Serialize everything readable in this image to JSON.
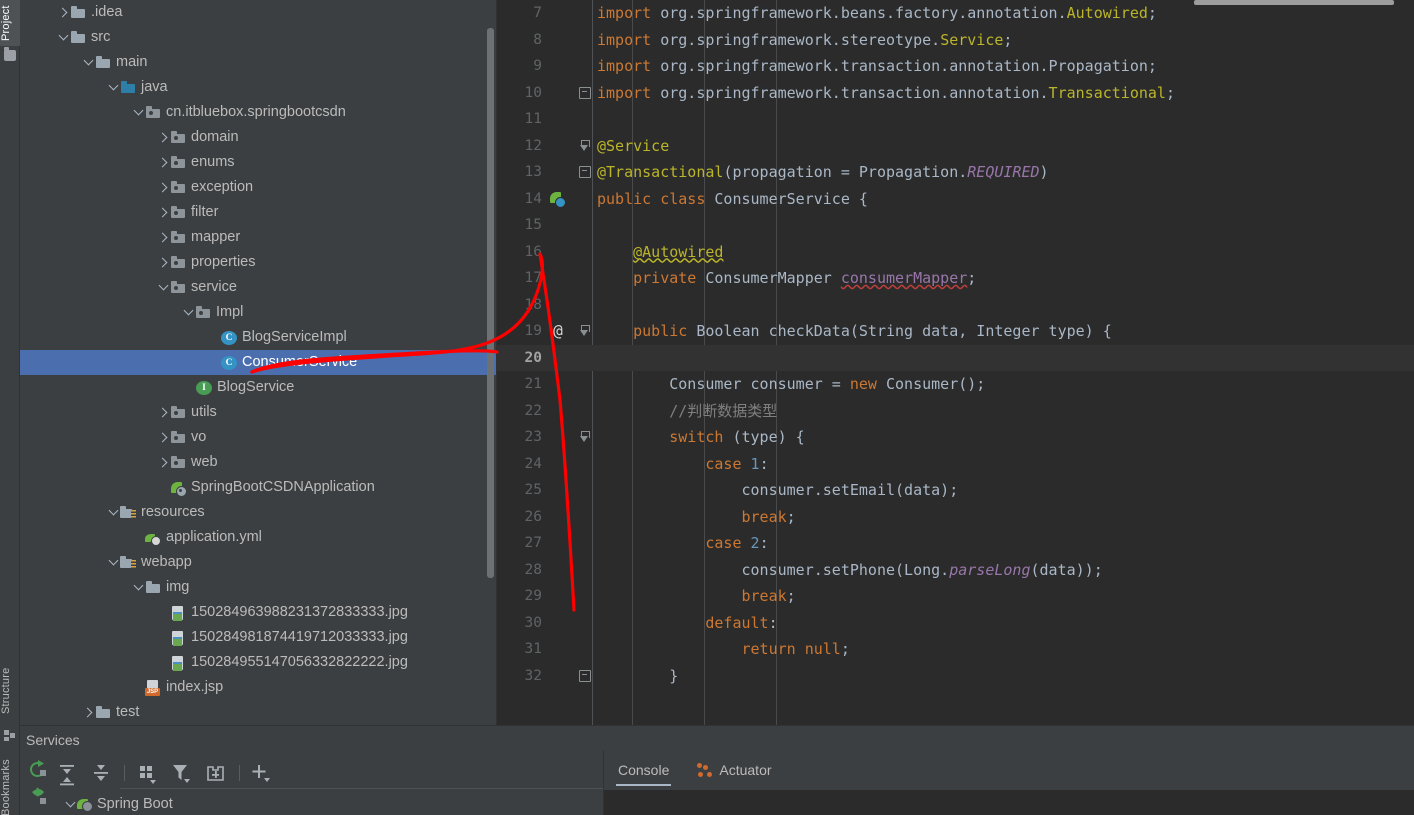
{
  "tool_strip": {
    "tabs": [
      {
        "label": "Project",
        "active": true
      },
      {
        "label": "Structure",
        "active": false
      },
      {
        "label": "Bookmarks",
        "active": false
      }
    ]
  },
  "project_tree": {
    "items": [
      {
        "label": ".idea",
        "indent": 1,
        "arrow": "right",
        "icon": "folder-icon",
        "selected": false
      },
      {
        "label": "src",
        "indent": 1,
        "arrow": "down",
        "icon": "folder-icon",
        "selected": false
      },
      {
        "label": "main",
        "indent": 2,
        "arrow": "down",
        "icon": "folder-icon",
        "selected": false
      },
      {
        "label": "java",
        "indent": 3,
        "arrow": "down",
        "icon": "source-root-icon",
        "selected": false
      },
      {
        "label": "cn.itbluebox.springbootcsdn",
        "indent": 4,
        "arrow": "down",
        "icon": "package-icon",
        "selected": false
      },
      {
        "label": "domain",
        "indent": 5,
        "arrow": "right",
        "icon": "package-icon",
        "selected": false
      },
      {
        "label": "enums",
        "indent": 5,
        "arrow": "right",
        "icon": "package-icon",
        "selected": false
      },
      {
        "label": "exception",
        "indent": 5,
        "arrow": "right",
        "icon": "package-icon",
        "selected": false
      },
      {
        "label": "filter",
        "indent": 5,
        "arrow": "right",
        "icon": "package-icon",
        "selected": false
      },
      {
        "label": "mapper",
        "indent": 5,
        "arrow": "right",
        "icon": "package-icon",
        "selected": false
      },
      {
        "label": "properties",
        "indent": 5,
        "arrow": "right",
        "icon": "package-icon",
        "selected": false
      },
      {
        "label": "service",
        "indent": 5,
        "arrow": "down",
        "icon": "package-icon",
        "selected": false
      },
      {
        "label": "Impl",
        "indent": 6,
        "arrow": "down",
        "icon": "package-icon",
        "selected": false
      },
      {
        "label": "BlogServiceImpl",
        "indent": 7,
        "arrow": "none",
        "icon": "class-icon",
        "selected": false
      },
      {
        "label": "ConsumerService",
        "indent": 7,
        "arrow": "none",
        "icon": "class-icon",
        "selected": true
      },
      {
        "label": "BlogService",
        "indent": 6,
        "arrow": "none",
        "icon": "interface-icon",
        "selected": false
      },
      {
        "label": "utils",
        "indent": 5,
        "arrow": "right",
        "icon": "package-icon",
        "selected": false
      },
      {
        "label": "vo",
        "indent": 5,
        "arrow": "right",
        "icon": "package-icon",
        "selected": false
      },
      {
        "label": "web",
        "indent": 5,
        "arrow": "right",
        "icon": "package-icon",
        "selected": false
      },
      {
        "label": "SpringBootCSDNApplication",
        "indent": 5,
        "arrow": "none",
        "icon": "spring-app-icon",
        "selected": false
      },
      {
        "label": "resources",
        "indent": 3,
        "arrow": "down",
        "icon": "resource-root-icon",
        "selected": false
      },
      {
        "label": "application.yml",
        "indent": 4,
        "arrow": "none",
        "icon": "yaml-file-icon",
        "selected": false
      },
      {
        "label": "webapp",
        "indent": 3,
        "arrow": "down",
        "icon": "resource-root-icon",
        "selected": false
      },
      {
        "label": "img",
        "indent": 4,
        "arrow": "down",
        "icon": "folder-icon",
        "selected": false
      },
      {
        "label": "150284963988231372833333.jpg",
        "indent": 5,
        "arrow": "none",
        "icon": "image-file-icon",
        "selected": false
      },
      {
        "label": "150284981874419712033333.jpg",
        "indent": 5,
        "arrow": "none",
        "icon": "image-file-icon",
        "selected": false
      },
      {
        "label": "150284955147056332822222.jpg",
        "indent": 5,
        "arrow": "none",
        "icon": "image-file-icon",
        "selected": false
      },
      {
        "label": "index.jsp",
        "indent": 4,
        "arrow": "none",
        "icon": "jsp-file-icon",
        "selected": false
      },
      {
        "label": "test",
        "indent": 2,
        "arrow": "right",
        "icon": "folder-icon",
        "selected": false
      }
    ]
  },
  "editor": {
    "lines": [
      {
        "num": "7",
        "gutter": "",
        "fold": "",
        "caret": false,
        "tokens": [
          {
            "t": "import ",
            "c": "k"
          },
          {
            "t": "org.springframework.beans.factory.annotation.",
            "c": "id"
          },
          {
            "t": "Autowired",
            "c": "ann"
          },
          {
            "t": ";",
            "c": "id"
          }
        ]
      },
      {
        "num": "8",
        "gutter": "",
        "fold": "",
        "caret": false,
        "tokens": [
          {
            "t": "import ",
            "c": "k"
          },
          {
            "t": "org.springframework.stereotype.",
            "c": "id"
          },
          {
            "t": "Service",
            "c": "ann"
          },
          {
            "t": ";",
            "c": "id"
          }
        ]
      },
      {
        "num": "9",
        "gutter": "",
        "fold": "",
        "caret": false,
        "tokens": [
          {
            "t": "import ",
            "c": "k"
          },
          {
            "t": "org.springframework.transaction.annotation.",
            "c": "id"
          },
          {
            "t": "Propagation",
            "c": "id"
          },
          {
            "t": ";",
            "c": "id"
          }
        ]
      },
      {
        "num": "10",
        "gutter": "",
        "fold": "fold-end",
        "caret": false,
        "tokens": [
          {
            "t": "import ",
            "c": "k"
          },
          {
            "t": "org.springframework.transaction.annotation.",
            "c": "id"
          },
          {
            "t": "Transactional",
            "c": "ann"
          },
          {
            "t": ";",
            "c": "id"
          }
        ]
      },
      {
        "num": "11",
        "gutter": "",
        "fold": "",
        "caret": false,
        "tokens": []
      },
      {
        "num": "12",
        "gutter": "",
        "fold": "fold-arrow",
        "caret": false,
        "tokens": [
          {
            "t": "@Service",
            "c": "ann"
          }
        ]
      },
      {
        "num": "13",
        "gutter": "",
        "fold": "fold-end",
        "caret": false,
        "tokens": [
          {
            "t": "@Transactional",
            "c": "ann"
          },
          {
            "t": "(propagation = Propagation.",
            "c": "id"
          },
          {
            "t": "REQUIRED",
            "c": "stat"
          },
          {
            "t": ")",
            "c": "id"
          }
        ]
      },
      {
        "num": "14",
        "gutter": "spring-bean-icon",
        "fold": "",
        "caret": false,
        "tokens": [
          {
            "t": "public ",
            "c": "k"
          },
          {
            "t": "class ",
            "c": "k"
          },
          {
            "t": "ConsumerService ",
            "c": "id"
          },
          {
            "t": "{",
            "c": "id"
          }
        ]
      },
      {
        "num": "15",
        "gutter": "",
        "fold": "",
        "caret": false,
        "tokens": []
      },
      {
        "num": "16",
        "gutter": "",
        "fold": "",
        "caret": false,
        "tokens": [
          {
            "t": "    ",
            "c": "id"
          },
          {
            "t": "@Autowired",
            "c": "ann sqy"
          }
        ]
      },
      {
        "num": "17",
        "gutter": "",
        "fold": "",
        "caret": false,
        "tokens": [
          {
            "t": "    ",
            "c": "id"
          },
          {
            "t": "private ",
            "c": "k"
          },
          {
            "t": "ConsumerMapper ",
            "c": "id"
          },
          {
            "t": "consumerMapper",
            "c": "fld sq"
          },
          {
            "t": ";",
            "c": "id"
          }
        ]
      },
      {
        "num": "18",
        "gutter": "",
        "fold": "",
        "caret": false,
        "tokens": []
      },
      {
        "num": "19",
        "gutter": "override-icon",
        "fold": "fold-arrow",
        "caret": false,
        "tokens": [
          {
            "t": "    ",
            "c": "id"
          },
          {
            "t": "public ",
            "c": "k"
          },
          {
            "t": "Boolean ",
            "c": "id"
          },
          {
            "t": "checkData",
            "c": "mdecl"
          },
          {
            "t": "(String data, Integer type) {",
            "c": "id"
          }
        ]
      },
      {
        "num": "20",
        "gutter": "",
        "fold": "",
        "caret": true,
        "tokens": []
      },
      {
        "num": "21",
        "gutter": "",
        "fold": "",
        "caret": false,
        "tokens": [
          {
            "t": "        ",
            "c": "id"
          },
          {
            "t": "Consumer consumer = ",
            "c": "id"
          },
          {
            "t": "new ",
            "c": "k"
          },
          {
            "t": "Consumer();",
            "c": "id"
          }
        ]
      },
      {
        "num": "22",
        "gutter": "",
        "fold": "",
        "caret": false,
        "tokens": [
          {
            "t": "        ",
            "c": "id"
          },
          {
            "t": "//判断数据类型",
            "c": "cm"
          }
        ]
      },
      {
        "num": "23",
        "gutter": "",
        "fold": "fold-arrow",
        "caret": false,
        "tokens": [
          {
            "t": "        ",
            "c": "id"
          },
          {
            "t": "switch ",
            "c": "k"
          },
          {
            "t": "(type) {",
            "c": "id"
          }
        ]
      },
      {
        "num": "24",
        "gutter": "",
        "fold": "",
        "caret": false,
        "tokens": [
          {
            "t": "            ",
            "c": "id"
          },
          {
            "t": "case ",
            "c": "k"
          },
          {
            "t": "1",
            "c": "num"
          },
          {
            "t": ":",
            "c": "id"
          }
        ]
      },
      {
        "num": "25",
        "gutter": "",
        "fold": "",
        "caret": false,
        "tokens": [
          {
            "t": "                ",
            "c": "id"
          },
          {
            "t": "consumer.setEmail(data);",
            "c": "id"
          }
        ]
      },
      {
        "num": "26",
        "gutter": "",
        "fold": "",
        "caret": false,
        "tokens": [
          {
            "t": "                ",
            "c": "id"
          },
          {
            "t": "break",
            "c": "k"
          },
          {
            "t": ";",
            "c": "id"
          }
        ]
      },
      {
        "num": "27",
        "gutter": "",
        "fold": "",
        "caret": false,
        "tokens": [
          {
            "t": "            ",
            "c": "id"
          },
          {
            "t": "case ",
            "c": "k"
          },
          {
            "t": "2",
            "c": "num"
          },
          {
            "t": ":",
            "c": "id"
          }
        ]
      },
      {
        "num": "28",
        "gutter": "",
        "fold": "",
        "caret": false,
        "tokens": [
          {
            "t": "                ",
            "c": "id"
          },
          {
            "t": "consumer.setPhone(Long.",
            "c": "id"
          },
          {
            "t": "parseLong",
            "c": "stat"
          },
          {
            "t": "(data));",
            "c": "id"
          }
        ]
      },
      {
        "num": "29",
        "gutter": "",
        "fold": "",
        "caret": false,
        "tokens": [
          {
            "t": "                ",
            "c": "id"
          },
          {
            "t": "break",
            "c": "k"
          },
          {
            "t": ";",
            "c": "id"
          }
        ]
      },
      {
        "num": "30",
        "gutter": "",
        "fold": "",
        "caret": false,
        "tokens": [
          {
            "t": "            ",
            "c": "id"
          },
          {
            "t": "default",
            "c": "k"
          },
          {
            "t": ":",
            "c": "id"
          }
        ]
      },
      {
        "num": "31",
        "gutter": "",
        "fold": "",
        "caret": false,
        "tokens": [
          {
            "t": "                ",
            "c": "id"
          },
          {
            "t": "return ",
            "c": "k"
          },
          {
            "t": "null",
            "c": "k"
          },
          {
            "t": ";",
            "c": "id"
          }
        ]
      },
      {
        "num": "32",
        "gutter": "",
        "fold": "fold-end",
        "caret": false,
        "tokens": [
          {
            "t": "        ",
            "c": "id"
          },
          {
            "t": "}",
            "c": "id"
          }
        ]
      }
    ]
  },
  "services": {
    "title": "Services",
    "toolbar": [
      {
        "name": "rerun-button",
        "label": "Rerun"
      },
      {
        "name": "expand-all-button",
        "label": "Expand All"
      },
      {
        "name": "collapse-all-button",
        "label": "Collapse All"
      },
      {
        "name": "group-by-button",
        "label": "Group By"
      },
      {
        "name": "filter-button",
        "label": "Filter"
      },
      {
        "name": "add-tab-button",
        "label": "Add Tab"
      },
      {
        "name": "add-button",
        "label": "Add"
      }
    ],
    "tree": [
      {
        "label": "Spring Boot",
        "expanded": true
      }
    ],
    "console_tabs": [
      {
        "label": "Console",
        "active": true,
        "icon": ""
      },
      {
        "label": "Actuator",
        "active": false,
        "icon": "actuator-icon"
      }
    ]
  },
  "colors": {
    "panel_bg": "#3c3f41",
    "editor_bg": "#2b2b2b",
    "selection": "#4b6eaf",
    "annotation_red": "#fe0000",
    "keyword": "#cc7832",
    "annotation_token": "#bbb529",
    "number": "#6897bb",
    "comment": "#808080",
    "static_field": "#9876aa"
  }
}
